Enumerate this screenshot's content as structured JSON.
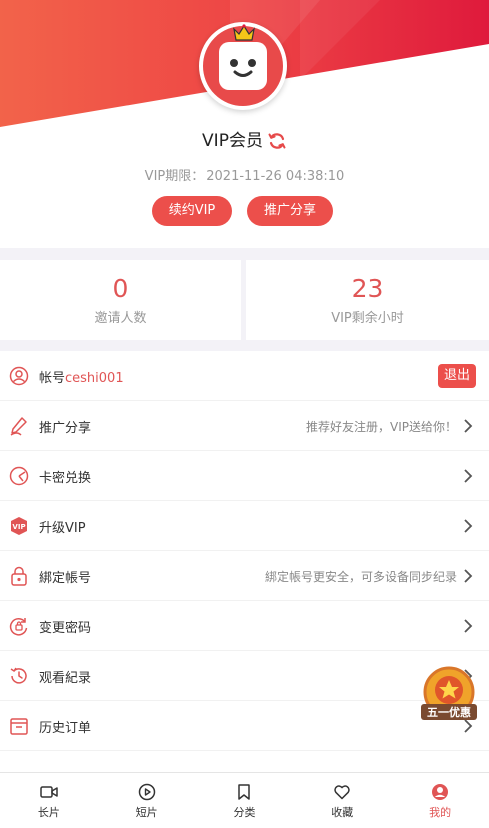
{
  "profile": {
    "title": "VIP会员",
    "expire_label": "VIP期限：",
    "expire_value": "2021-11-26 04:38:10",
    "renew_label": "续约VIP",
    "promo_label": "推广分享"
  },
  "stats": [
    {
      "value": "0",
      "label": "邀请人数"
    },
    {
      "value": "23",
      "label": "VIP剩余小时"
    }
  ],
  "account_row": {
    "prefix": "帐号",
    "account": "ceshi001",
    "logout_label": "退出"
  },
  "menu": [
    {
      "label": "推广分享",
      "hint": "推荐好友注册，VIP送给你！",
      "icon": "pen-icon"
    },
    {
      "label": "卡密兑换",
      "hint": "",
      "icon": "card-icon"
    },
    {
      "label": "升级VIP",
      "hint": "",
      "icon": "vip-icon"
    },
    {
      "label": "綁定帳号",
      "hint": "綁定帳号更安全，可多设备同步纪录",
      "icon": "lock-icon"
    },
    {
      "label": "变更密码",
      "hint": "",
      "icon": "password-icon"
    },
    {
      "label": "观看紀录",
      "hint": "",
      "icon": "history-icon"
    },
    {
      "label": "历史订单",
      "hint": "",
      "icon": "order-icon"
    }
  ],
  "promo_badge": {
    "label": "五一优惠"
  },
  "tabs": [
    {
      "label": "长片",
      "icon": "video-camera-icon"
    },
    {
      "label": "短片",
      "icon": "play-circle-icon"
    },
    {
      "label": "分类",
      "icon": "bookmark-icon"
    },
    {
      "label": "收藏",
      "icon": "heart-icon"
    },
    {
      "label": "我的",
      "icon": "user-icon"
    }
  ],
  "colors": {
    "accent": "#ec4f4b",
    "accent_text": "#e05555",
    "header_gradient_start": "#f06a4a",
    "header_gradient_end": "#e0183c"
  }
}
